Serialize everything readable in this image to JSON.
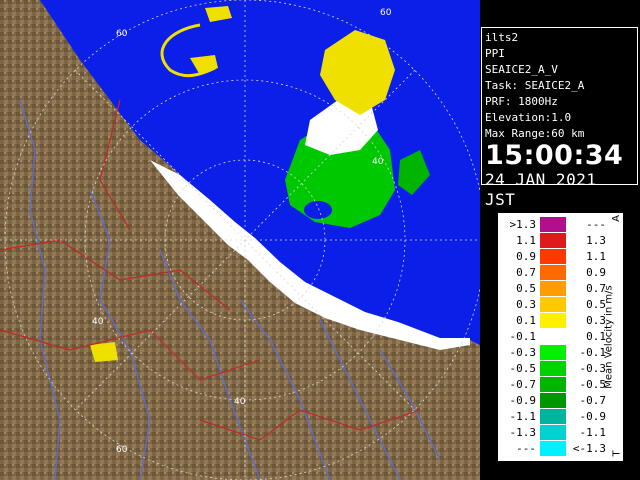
{
  "info": {
    "station": "ilts2",
    "product": "PPI",
    "product_name": "SEAICE2_A_V",
    "task": "Task: SEAICE2_A",
    "prf": "PRF: 1800Hz",
    "elevation": "Elevation:1.0",
    "max_range": "Max Range:60 km",
    "time": "15:00:34",
    "date": "24 JAN 2021 JST"
  },
  "map": {
    "range_labels": [
      "60",
      "40",
      "40",
      "40",
      "40",
      "60",
      "60"
    ],
    "colors": {
      "sea": "#0b1fe8",
      "land": "#7d6646",
      "river": "#5a6bd8",
      "boundary": "#c02828"
    }
  },
  "legend": {
    "title": "Mean Velocity in m/s",
    "corner_top": "A",
    "corner_bottom": "T",
    "rows": [
      {
        "lo": ">1.3",
        "hi": "---",
        "color": "#b0108c"
      },
      {
        "lo": "1.1",
        "hi": "1.3",
        "color": "#e01a1a"
      },
      {
        "lo": "0.9",
        "hi": "1.1",
        "color": "#ff3800"
      },
      {
        "lo": "0.7",
        "hi": "0.9",
        "color": "#ff6a00"
      },
      {
        "lo": "0.5",
        "hi": "0.7",
        "color": "#ff9c00"
      },
      {
        "lo": "0.3",
        "hi": "0.5",
        "color": "#ffc800"
      },
      {
        "lo": "0.1",
        "hi": "0.3",
        "color": "#fff000"
      },
      {
        "lo": "-0.1",
        "hi": "0.1",
        "color": "#ffffff"
      },
      {
        "lo": "-0.3",
        "hi": "-0.1",
        "color": "#00f000"
      },
      {
        "lo": "-0.5",
        "hi": "-0.3",
        "color": "#00d200"
      },
      {
        "lo": "-0.7",
        "hi": "-0.5",
        "color": "#00b400"
      },
      {
        "lo": "-0.9",
        "hi": "-0.7",
        "color": "#009600"
      },
      {
        "lo": "-1.1",
        "hi": "-0.9",
        "color": "#00b4a0"
      },
      {
        "lo": "-1.3",
        "hi": "-1.1",
        "color": "#00d2d2"
      },
      {
        "lo": "---",
        "hi": "<-1.3",
        "color": "#00f0ff"
      }
    ]
  }
}
